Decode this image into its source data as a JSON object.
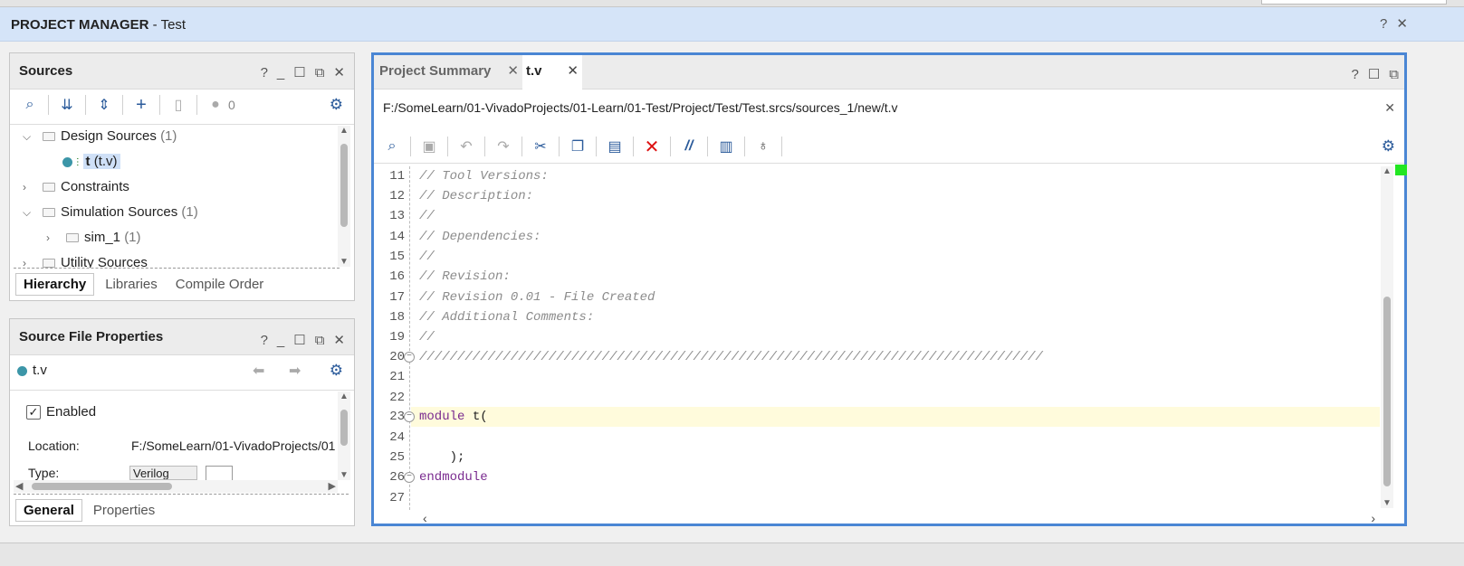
{
  "window": {
    "title_bold": "PROJECT MANAGER",
    "title_rest": " - Test"
  },
  "sources_panel": {
    "title": "Sources",
    "status_count": "0",
    "tree": [
      {
        "label": "Design Sources",
        "count": "(1)"
      },
      {
        "label_bold": "t",
        "label_rest": " (t.v)"
      },
      {
        "label": "Constraints"
      },
      {
        "label": "Simulation Sources",
        "count": "(1)"
      },
      {
        "label": "sim_1",
        "count": "(1)"
      },
      {
        "label": "Utility Sources"
      }
    ],
    "tabs": [
      "Hierarchy",
      "Libraries",
      "Compile Order"
    ]
  },
  "props_panel": {
    "title": "Source File Properties",
    "file": "t.v",
    "enabled_label": "Enabled",
    "location_label": "Location:",
    "location_value": "F:/SomeLearn/01-VivadoProjects/01",
    "type_label": "Type:",
    "type_value": "Verilog",
    "tabs": [
      "General",
      "Properties"
    ]
  },
  "editor": {
    "tabs": [
      "Project Summary",
      "t.v"
    ],
    "path": "F:/SomeLearn/01-VivadoProjects/01-Learn/01-Test/Project/Test/Test.srcs/sources_1/new/t.v",
    "lines": [
      {
        "n": "11",
        "text": "// Tool Versions:"
      },
      {
        "n": "12",
        "text": "// Description:"
      },
      {
        "n": "13",
        "text": "//"
      },
      {
        "n": "14",
        "text": "// Dependencies:"
      },
      {
        "n": "15",
        "text": "//"
      },
      {
        "n": "16",
        "text": "// Revision:"
      },
      {
        "n": "17",
        "text": "// Revision 0.01 - File Created"
      },
      {
        "n": "18",
        "text": "// Additional Comments:"
      },
      {
        "n": "19",
        "text": "//"
      },
      {
        "n": "20",
        "text": "//////////////////////////////////////////////////////////////////////////////////"
      },
      {
        "n": "21",
        "text": ""
      },
      {
        "n": "22",
        "text": ""
      },
      {
        "n": "23",
        "kw": "module",
        "rest": " t("
      },
      {
        "n": "24",
        "text": ""
      },
      {
        "n": "25",
        "rest": "    );"
      },
      {
        "n": "26",
        "kw": "endmodule",
        "rest": ""
      },
      {
        "n": "27",
        "text": ""
      }
    ]
  },
  "icons": {
    "help": "question-icon",
    "minimize": "minimize-icon",
    "maximize": "maximize-icon",
    "float": "float-icon",
    "close": "close-icon",
    "settings": "gear-icon"
  }
}
